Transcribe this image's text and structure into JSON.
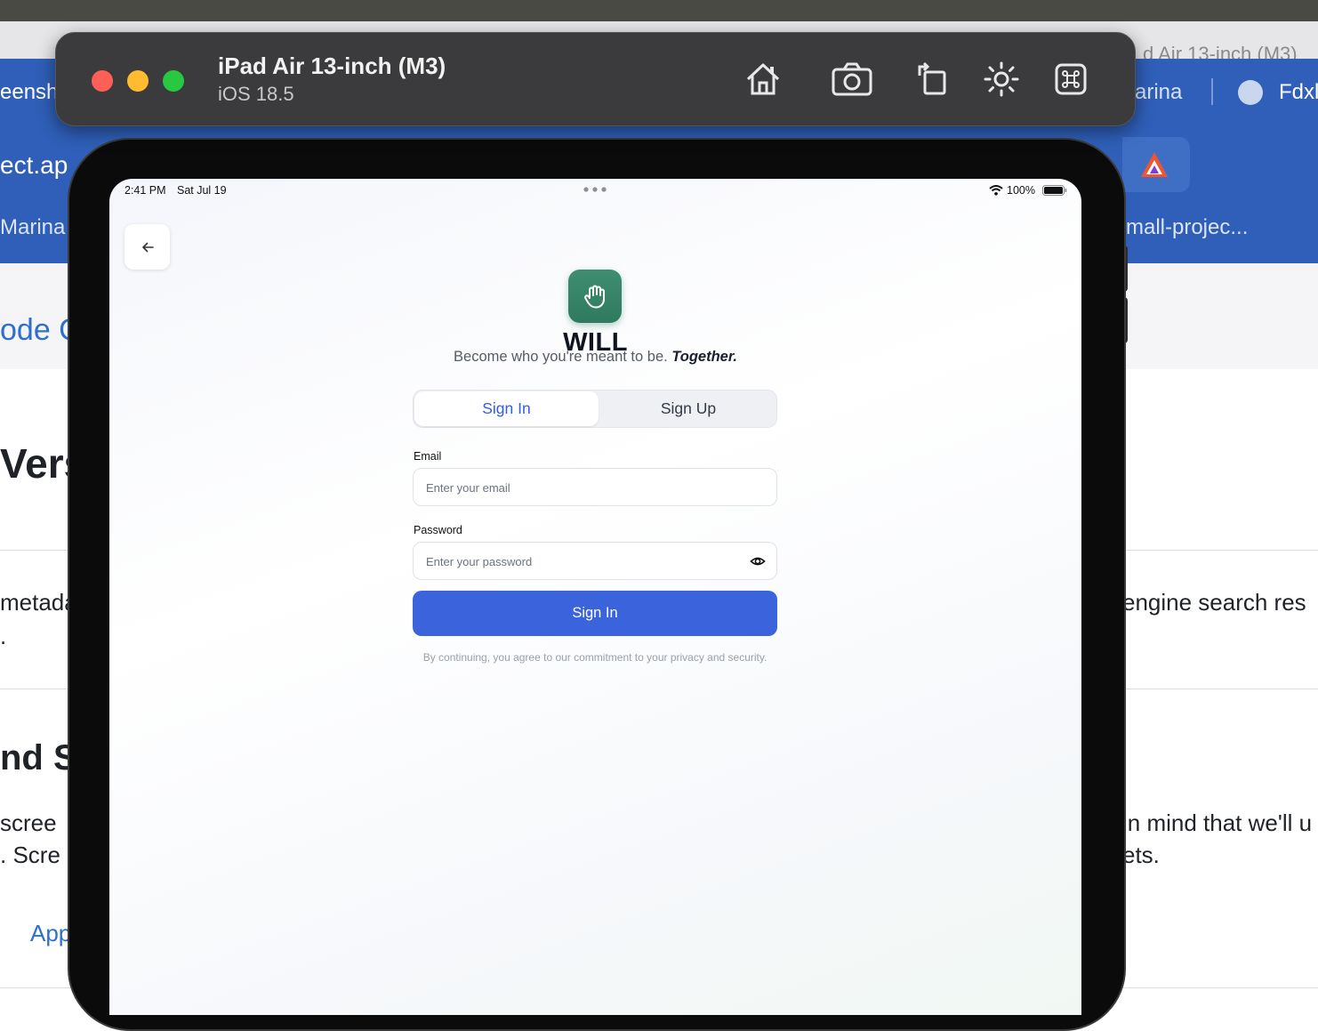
{
  "simulator": {
    "device_name": "iPad Air 13-inch (M3)",
    "os_version": "iOS 18.5",
    "toolbar_icons": [
      "home-icon",
      "screenshot-icon",
      "rotate-icon",
      "appearance-icon",
      "command-icon"
    ]
  },
  "background_page": {
    "tab_text_left": "eensh",
    "tab_text_right": "arina",
    "tab_text_far_right": "Fdxl",
    "tab_title_behind": "d Air 13-inch (M3)",
    "address_text": "ect.ap",
    "bookmark_left": "Marina",
    "bookmark_right": "mall-projec...",
    "heading_link": "ode C",
    "heading_version": "Vers",
    "text_metadata_1": "metada",
    "text_metadata_2": ".",
    "text_search_results": "engine search res",
    "heading_and": "nd S",
    "text_screen_1": "scree",
    "text_screen_2": ". Scre",
    "text_in_mind": "in mind that we'll u",
    "text_ets": "ets.",
    "link_app": "App"
  },
  "status_bar": {
    "time": "2:41 PM",
    "date": "Sat Jul 19",
    "battery": "100%"
  },
  "app": {
    "brand": "WILL",
    "tagline_prefix": "Become who you're meant to be. ",
    "tagline_emphasis": "Together.",
    "tabs": {
      "sign_in": "Sign In",
      "sign_up": "Sign Up"
    },
    "email": {
      "label": "Email",
      "placeholder": "Enter your email"
    },
    "password": {
      "label": "Password",
      "placeholder": "Enter your password"
    },
    "submit_label": "Sign In",
    "terms": "By continuing, you agree to our commitment to your privacy and security."
  },
  "colors": {
    "accent": "#3a63dc",
    "logo_green": "#2f7a5f",
    "window_red": "#ff5f57",
    "window_yellow": "#febc2e",
    "window_green": "#28c840"
  }
}
